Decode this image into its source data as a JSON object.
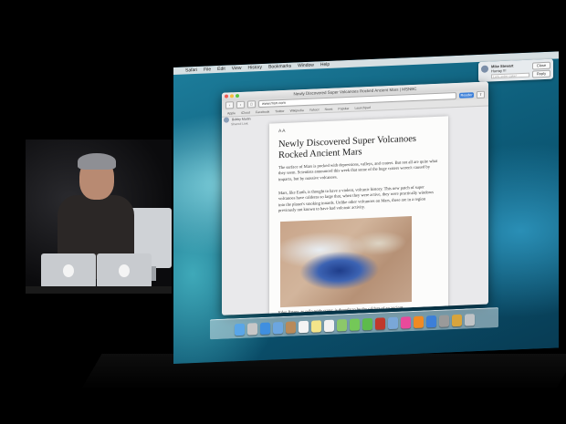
{
  "colors": {
    "wallpaper": "#0e5f7c",
    "reader_button": "#3b7fd9",
    "traffic_red": "#f05c55",
    "traffic_yellow": "#f6bd3c",
    "traffic_green": "#5cc644"
  },
  "menubar": {
    "apple": "",
    "items": [
      "Safari",
      "File",
      "Edit",
      "View",
      "History",
      "Bookmarks",
      "Window",
      "Help"
    ]
  },
  "notification": {
    "from": "Mike Stewart",
    "subject": "Hurray !!!",
    "reply_placeholder": "Let's order cake!",
    "close_label": "Close",
    "reply_label": "Reply"
  },
  "safari": {
    "window_title": "Newly Discovered Super Volcanoes Rocked Ancient Mars | MSNBC",
    "address": "www.msn.com",
    "reader_label": "Reader",
    "bookmarks": [
      "Apple",
      "iCloud",
      "Facebook",
      "Twitter",
      "Wikipedia",
      "Yahoo!",
      "News",
      "Popular",
      "Launchpad"
    ],
    "shared_author": "Bobby Martin",
    "shared_note": "Shared Link"
  },
  "article": {
    "controls": "A  A",
    "title": "Newly Discovered Super Volcanoes Rocked Ancient Mars",
    "p1": "The surface of Mars is pocked with depressions, valleys, and craters. But not all are quite what they seem. Scientists announced this week that some of the huge craters weren't caused by impacts, but by massive volcanoes.",
    "p2": "Mars, like Earth, is thought to have a violent, volcanic history. This new patch of super volcanoes have calderas so large that, when they were active, they were practically windows into the planet's smoking innards. Unlike other volcanoes on Mars, these are in a region previously not known to have had volcanic activity.",
    "p3": "Eden Patera, as mile-wide crater, is thought to be the caldera of an ancient"
  },
  "dock": {
    "icons": [
      "finder-icon",
      "launchpad-icon",
      "safari-icon",
      "mail-icon",
      "contacts-icon",
      "calendar-icon",
      "notes-icon",
      "reminders-icon",
      "maps-icon",
      "messages-icon",
      "facetime-icon",
      "photo-booth-icon",
      "iphoto-icon",
      "itunes-icon",
      "ibooks-icon",
      "app-store-icon",
      "system-preferences-icon",
      "documents-icon",
      "trash-icon"
    ],
    "icon_colors": [
      "#5aa6e8",
      "#c7c7c7",
      "#3f8fe0",
      "#6ca6e0",
      "#b88a5a",
      "#f4f4f4",
      "#f3e48a",
      "#f2f2f2",
      "#8cc86a",
      "#74c858",
      "#5dbb4c",
      "#c0392b",
      "#7aa7d8",
      "#e84a9b",
      "#f08a24",
      "#3c7fd8",
      "#9a9a9a",
      "#d8a43c",
      "#bfc3c6"
    ]
  }
}
